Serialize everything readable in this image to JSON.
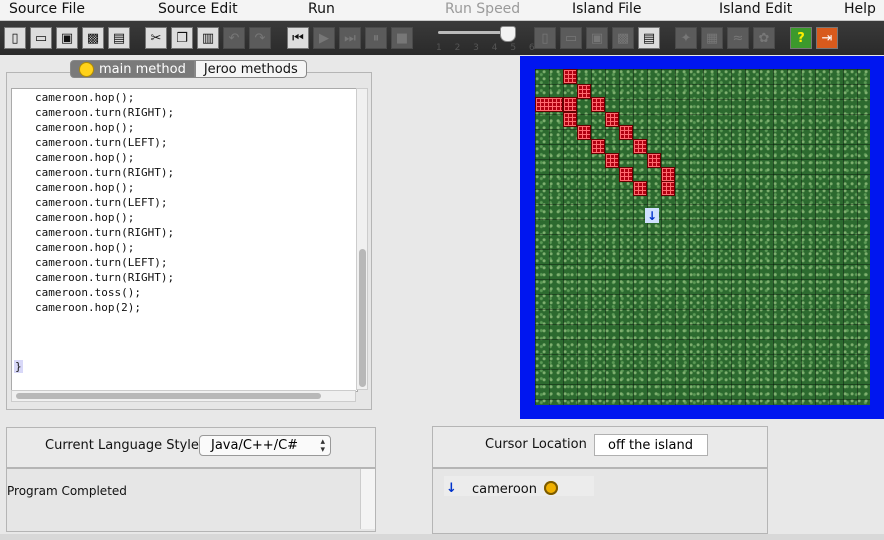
{
  "menubar": {
    "items": [
      "Source File",
      "Source Edit",
      "Run",
      "Run Speed",
      "Island File",
      "Island Edit",
      "Help"
    ]
  },
  "toolbar": {
    "source_buttons": [
      "new-file-icon",
      "open-file-icon",
      "save-icon",
      "save-as-icon",
      "print-icon"
    ],
    "edit_buttons": [
      "cut-icon",
      "copy-icon",
      "paste-icon",
      "undo-icon",
      "redo-icon"
    ],
    "run_buttons": [
      "reset-icon",
      "run-continuous-icon",
      "step-icon",
      "pause-icon",
      "stop-icon"
    ],
    "island_buttons": [
      "new-island-icon",
      "open-island-icon",
      "save-island-icon",
      "save-island-as-icon",
      "print-island-icon"
    ],
    "island_edit_buttons": [
      "clear-island-icon",
      "grid-icon",
      "water-icon",
      "flower-tool-icon"
    ],
    "help_buttons": [
      "help-icon",
      "exit-icon"
    ],
    "run_speed": {
      "ticks": "1 2 3 4 5 6",
      "value": 6
    }
  },
  "editor": {
    "tabs": [
      "main method",
      "Jeroo methods"
    ],
    "active_tab": "main method",
    "code_lines": [
      "cameroon.hop();",
      "cameroon.turn(RIGHT);",
      "cameroon.hop();",
      "cameroon.turn(LEFT);",
      "cameroon.hop();",
      "cameroon.turn(RIGHT);",
      "cameroon.hop();",
      "cameroon.turn(LEFT);",
      "cameroon.hop();",
      "cameroon.turn(RIGHT);",
      "cameroon.hop();",
      "cameroon.turn(LEFT);",
      "cameroon.turn(RIGHT);",
      "cameroon.toss();",
      "cameroon.hop(2);"
    ],
    "closing_brace": "}"
  },
  "language": {
    "label": "Current Language Style",
    "selected": "Java/C++/C#"
  },
  "status": {
    "message": "Program Completed"
  },
  "cursor": {
    "label": "Cursor Location",
    "value": "off the island"
  },
  "jeroos": [
    {
      "name": "cameroon",
      "direction": "south"
    }
  ],
  "colors": {
    "water": "#0016f0",
    "grass": "#2c6a2f",
    "net": "#b00010",
    "jeroo": "#0033cc"
  }
}
